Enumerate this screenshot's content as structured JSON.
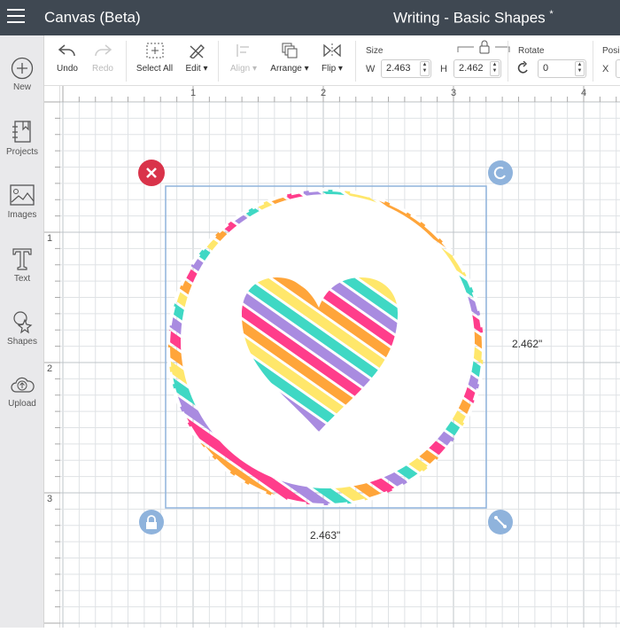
{
  "header": {
    "app_title": "Canvas (Beta)",
    "doc_title": "Writing - Basic Shapes",
    "unsaved_mark": "*"
  },
  "sidebar": {
    "items": [
      {
        "label": "New",
        "icon": "plus-circle-icon"
      },
      {
        "label": "Projects",
        "icon": "notebook-icon"
      },
      {
        "label": "Images",
        "icon": "image-icon"
      },
      {
        "label": "Text",
        "icon": "text-t-icon"
      },
      {
        "label": "Shapes",
        "icon": "shapes-icon"
      },
      {
        "label": "Upload",
        "icon": "cloud-upload-icon"
      }
    ]
  },
  "toolbar": {
    "undo": "Undo",
    "redo": "Redo",
    "select_all": "Select All",
    "edit": "Edit",
    "align": "Align",
    "arrange": "Arrange",
    "flip": "Flip",
    "size_label": "Size",
    "w_label": "W",
    "w_value": "2.463",
    "h_label": "H",
    "h_value": "2.462",
    "rotate_label": "Rotate",
    "rotate_value": "0",
    "position_label": "Posi",
    "x_label": "X"
  },
  "rulers": {
    "horizontal": [
      "1",
      "2",
      "3",
      "4"
    ],
    "vertical": [
      "1",
      "2",
      "3"
    ]
  },
  "selection": {
    "width_label": "2.463\"",
    "height_label": "2.462\""
  },
  "colors": {
    "header": "#3f4852",
    "selection": "#8fb3dc",
    "delete": "#d9334a",
    "handle": "#8fb3dc",
    "stripes": [
      "#ff3d8b",
      "#ffa53a",
      "#ffe76b",
      "#3fd8c4",
      "#a98be0"
    ]
  }
}
